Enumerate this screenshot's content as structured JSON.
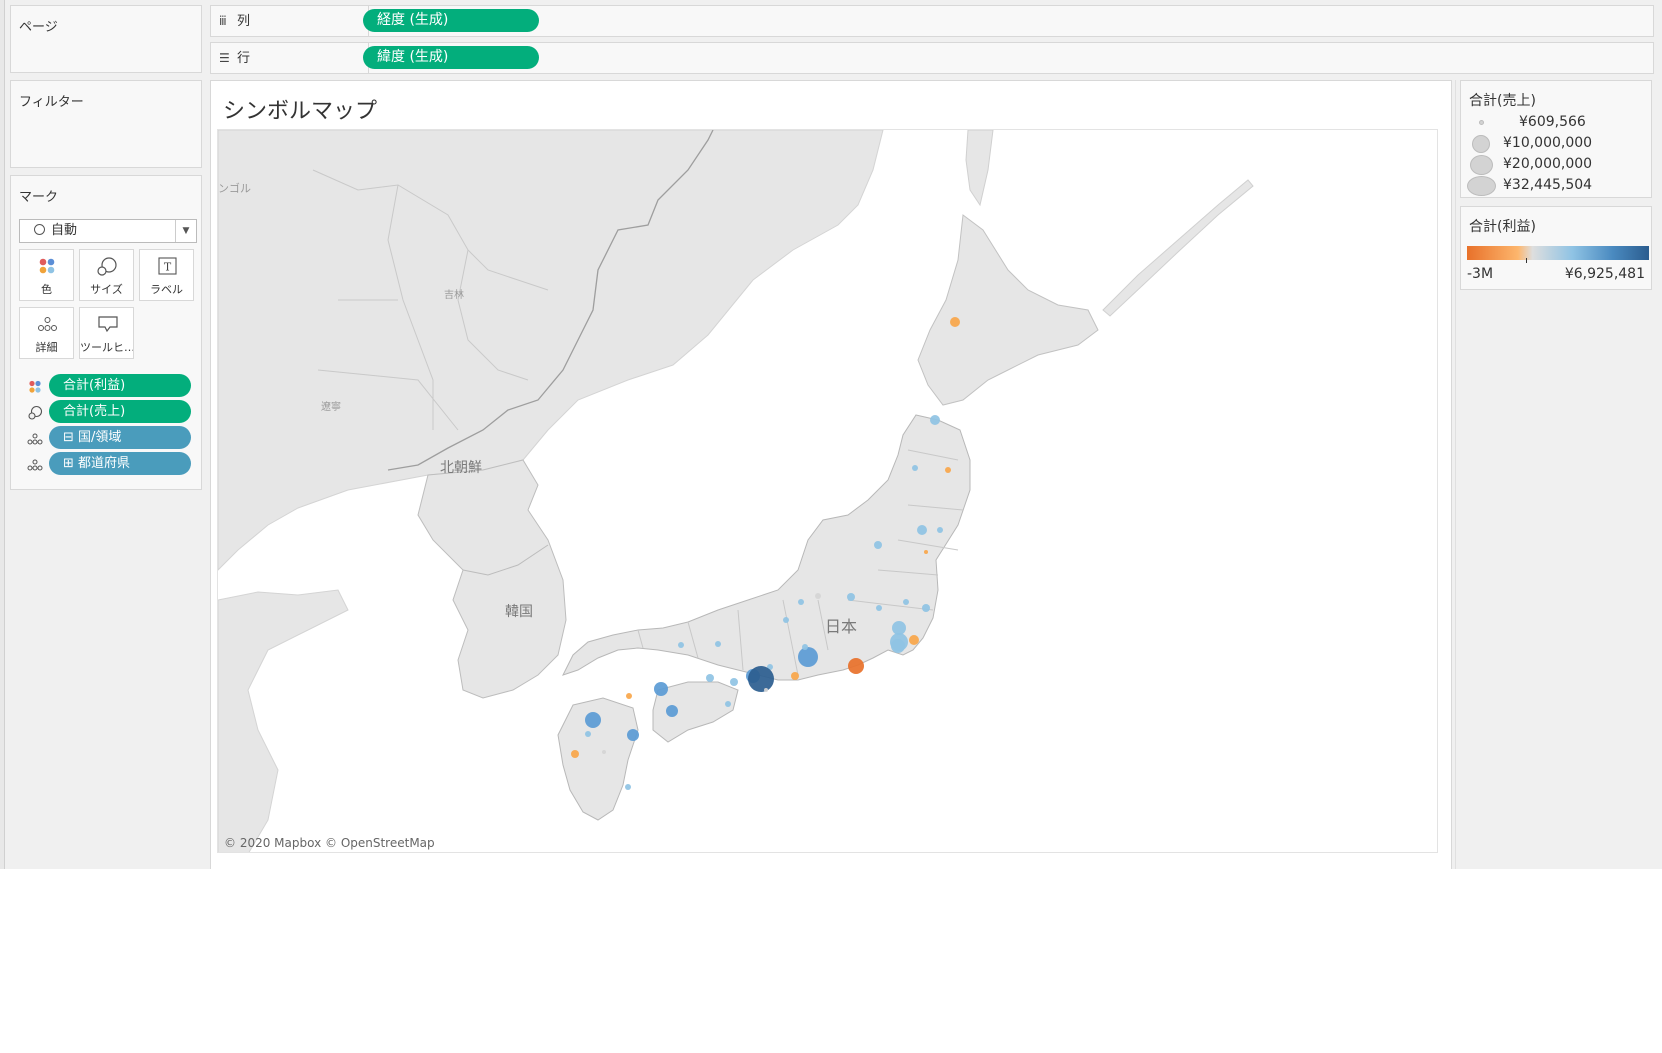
{
  "panels": {
    "pages": "ページ",
    "filters": "フィルター",
    "marks": "マーク"
  },
  "shelves": {
    "columns": {
      "label": "列",
      "icon": "columns-icon",
      "pill": "経度 (生成)"
    },
    "rows": {
      "label": "行",
      "icon": "rows-icon",
      "pill": "緯度 (生成)"
    }
  },
  "marks": {
    "type": "自動",
    "buttons": {
      "color": "色",
      "size": "サイズ",
      "label": "ラベル",
      "detail": "詳細",
      "tooltip": "ツールヒ…"
    },
    "fields": [
      {
        "icon": "color-icon",
        "label": "合計(利益)",
        "color": "#03ae7c"
      },
      {
        "icon": "size-icon",
        "label": "合計(売上)",
        "color": "#03ae7c"
      },
      {
        "icon": "detail-icon",
        "label": "⊟ 国/領域",
        "color": "#4a9cbc"
      },
      {
        "icon": "detail-icon",
        "label": "⊞ 都道府県",
        "color": "#4a9cbc"
      }
    ]
  },
  "viz": {
    "title": "シンボルマップ",
    "attribution": "© 2020 Mapbox © OpenStreetMap",
    "map_labels": {
      "mongolia": "ンゴル",
      "jilin": "吉林",
      "liaoning": "遼寧",
      "north_korea": "北朝鮮",
      "south_korea": "韓国",
      "japan": "日本"
    },
    "colors": {
      "land": "#e6e6e6",
      "sea": "#ffffff",
      "border": "#a0a0a0",
      "orange_strong": "#e8712a",
      "orange_light": "#f9a64a",
      "blue_light": "#8fc3e4",
      "blue_mid": "#5b9bd5",
      "blue_dark": "#2b5d8f"
    }
  },
  "legends": {
    "size": {
      "title": "合計(売上)",
      "items": [
        "¥609,566",
        "¥10,000,000",
        "¥20,000,000",
        "¥32,445,504"
      ]
    },
    "color": {
      "title": "合計(利益)",
      "min": "-3M",
      "max": "¥6,925,481"
    }
  }
}
